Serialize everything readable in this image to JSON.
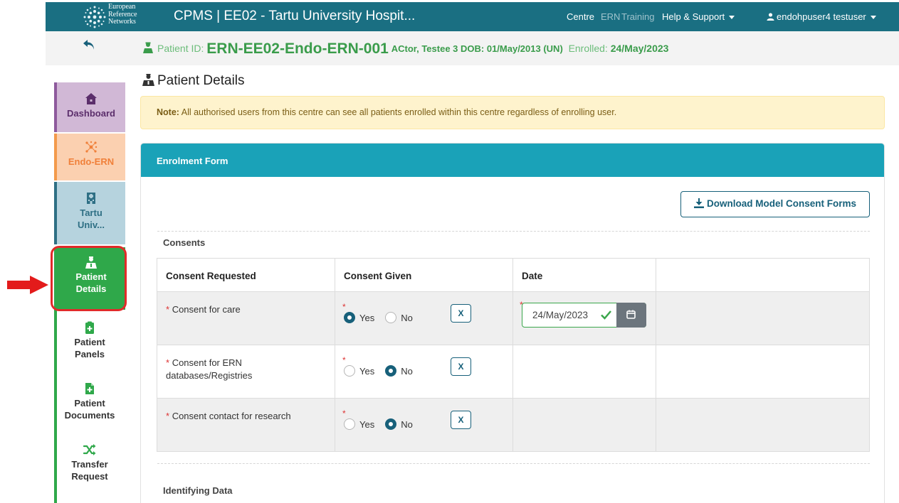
{
  "header": {
    "logo_text": [
      "European",
      "Reference",
      "Networks"
    ],
    "app_title": "CPMS | EE02 - Tartu University Hospit...",
    "nav": {
      "centre": "Centre",
      "ern": "ERN",
      "training": "Training",
      "help": "Help & Support",
      "user": "endohpuser4 testuser"
    }
  },
  "patient": {
    "id_label": "Patient ID:",
    "id": "ERN-EE02-Endo-ERN-001",
    "name_dob": "ACtor, Testee 3 DOB: 01/May/2013 (UN)",
    "enrolled_label": "Enrolled:",
    "enrolled_date": "24/May/2023"
  },
  "sidebar": {
    "items": [
      {
        "label": "Dashboard",
        "icon": "home-icon"
      },
      {
        "label": "Endo-ERN",
        "icon": "network-icon"
      },
      {
        "label_line1": "Tartu",
        "label_line2": "Univ...",
        "icon": "hospital-icon"
      },
      {
        "label_line1": "Patient",
        "label_line2": "Details",
        "icon": "patient-icon"
      },
      {
        "label_line1": "Patient",
        "label_line2": "Panels",
        "icon": "clipboard-plus-icon"
      },
      {
        "label_line1": "Patient",
        "label_line2": "Documents",
        "icon": "file-plus-icon"
      },
      {
        "label_line1": "Transfer",
        "label_line2": "Request",
        "icon": "shuffle-icon"
      }
    ]
  },
  "page": {
    "title": "Patient Details",
    "note_bold": "Note:",
    "note_text": " All authorised users from this centre can see all patients enrolled within this centre regardless of enrolling user."
  },
  "form": {
    "header": "Enrolment Form",
    "download_button": "Download Model Consent Forms",
    "consents_label": "Consents",
    "columns": [
      "Consent Requested",
      "Consent Given",
      "Date"
    ],
    "rows": [
      {
        "label": "Consent for care",
        "given": "Yes",
        "date": "24/May/2023"
      },
      {
        "label_line1": "Consent for ERN",
        "label_line2": "databases/Registries",
        "given": "No",
        "date": ""
      },
      {
        "label": "Consent contact for research",
        "given": "No",
        "date": ""
      }
    ],
    "radio_yes": "Yes",
    "radio_no": "No",
    "clear_button": "X",
    "required_mark": "*",
    "identifying_label": "Identifying Data"
  },
  "colors": {
    "topbar": "#1a6f82",
    "accent_green": "#2fa84a",
    "card_header": "#1aa2b8",
    "highlight": "#e12a2a"
  }
}
